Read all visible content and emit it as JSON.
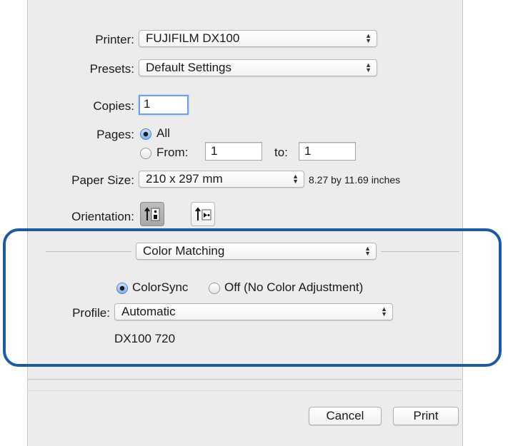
{
  "colors": {
    "panel_bg": "#ececec",
    "highlight_border": "#1f5a9e",
    "radio_selected": "#4a82d2",
    "focus_ring": "#6aa3e8"
  },
  "printer": {
    "label": "Printer:",
    "value": "FUJIFILM DX100"
  },
  "presets": {
    "label": "Presets:",
    "value": "Default Settings"
  },
  "copies": {
    "label": "Copies:",
    "value": "1"
  },
  "pages": {
    "label": "Pages:",
    "all_label": "All",
    "from_label": "From:",
    "from_value": "1",
    "to_label": "to:",
    "to_value": "1",
    "selected": "All"
  },
  "paper_size": {
    "label": "Paper Size:",
    "value": "210 x 297 mm",
    "dimensions": "8.27 by 11.69 inches"
  },
  "orientation": {
    "label": "Orientation:",
    "options": [
      {
        "icon": "portrait-orientation-icon",
        "selected": true
      },
      {
        "icon": "landscape-orientation-icon",
        "selected": false
      }
    ]
  },
  "section": {
    "value": "Color Matching"
  },
  "color_mode": {
    "options": [
      "ColorSync",
      "Off (No Color Adjustment)"
    ],
    "selected": "ColorSync"
  },
  "profile": {
    "label": "Profile:",
    "value": "Automatic",
    "name": "DX100 720"
  },
  "buttons": {
    "cancel": "Cancel",
    "print": "Print"
  }
}
